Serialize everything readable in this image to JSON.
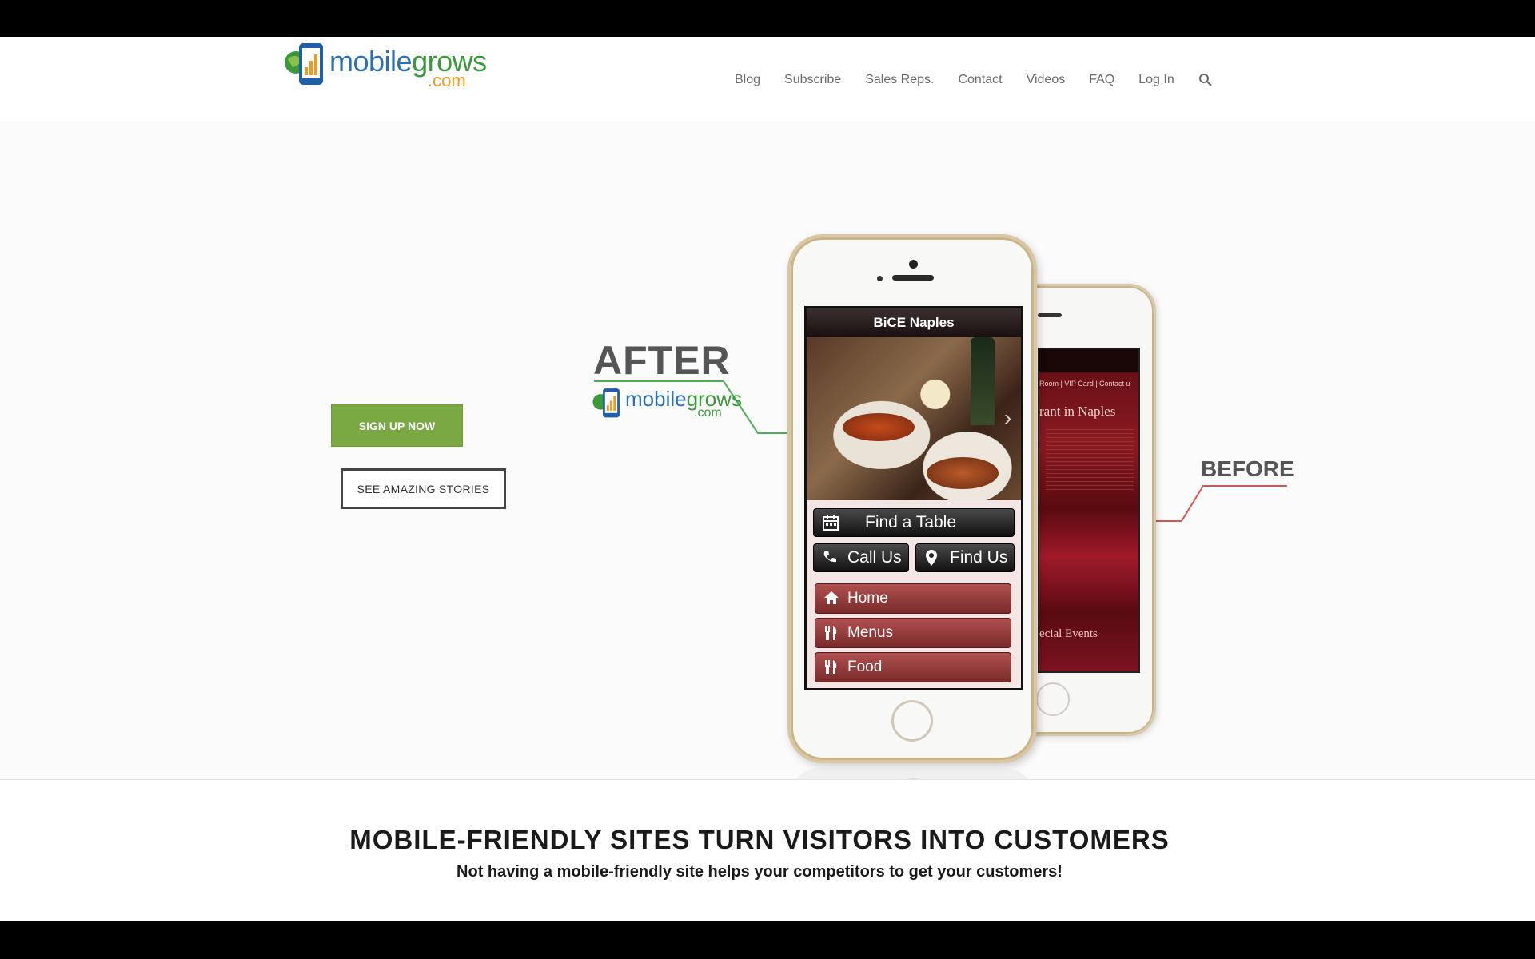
{
  "header": {
    "logo": {
      "word_main": "mobile",
      "word_accent": "grows",
      "dotcom": ".com"
    },
    "nav": [
      {
        "label": "Blog"
      },
      {
        "label": "Subscribe"
      },
      {
        "label": "Sales Reps."
      },
      {
        "label": "Contact"
      },
      {
        "label": "Videos"
      },
      {
        "label": "FAQ"
      },
      {
        "label": "Log In"
      }
    ],
    "search_icon": "search-icon"
  },
  "hero": {
    "signup_label": "SIGN UP NOW",
    "stories_label": "SEE AMAZING STORIES",
    "after_label": "AFTER",
    "before_label": "BEFORE",
    "after_logo": {
      "word_main": "mobile",
      "word_accent": "grows",
      "dotcom": ".com"
    },
    "front_phone": {
      "title": "BiCE Naples",
      "find_table": "Find a Table",
      "call_us": "Call Us",
      "find_us": "Find Us",
      "menu": [
        {
          "label": "Home",
          "icon": "home-icon"
        },
        {
          "label": "Menus",
          "icon": "utensils-icon"
        },
        {
          "label": "Food",
          "icon": "utensils-icon"
        }
      ]
    },
    "back_phone": {
      "nav_text": "Room | VIP Card | Contact u",
      "title_text": "rant in Naples",
      "events_text": "ecial Events"
    }
  },
  "tagline": {
    "headline": "MOBILE-FRIENDLY SITES TURN VISITORS INTO CUSTOMERS",
    "subline": "Not having a mobile-friendly site helps your competitors to get your customers!"
  },
  "colors": {
    "signup_green": "#7aa843",
    "after_line_green": "#4caf50",
    "before_line_red": "#d9534f",
    "logo_blue": "#2a6fb5",
    "logo_orange": "#f39a1e"
  }
}
